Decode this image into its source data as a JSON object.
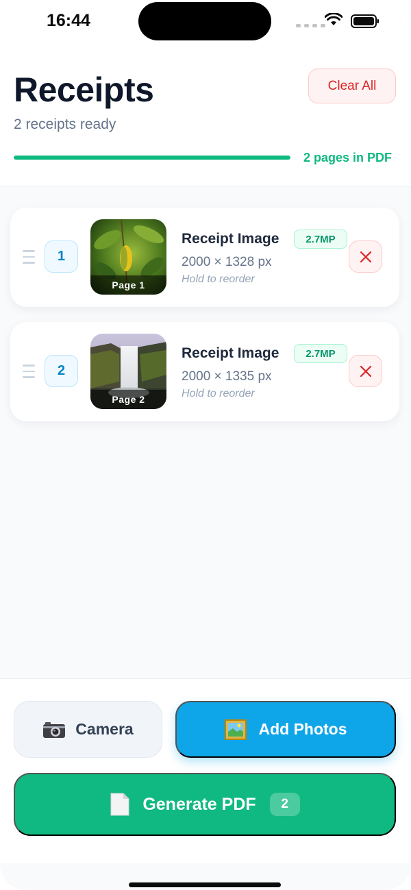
{
  "status_bar": {
    "time": "16:44"
  },
  "header": {
    "title": "Receipts",
    "subtitle": "2 receipts ready",
    "clear_all_label": "Clear All",
    "progress": 1.0,
    "pages_label": "2 pages in PDF"
  },
  "receipts": [
    {
      "index": "1",
      "page_label": "Page 1",
      "title": "Receipt Image",
      "megapixels": "2.7MP",
      "dimensions": "2000 × 1328 px",
      "hint": "Hold to reorder"
    },
    {
      "index": "2",
      "page_label": "Page 2",
      "title": "Receipt Image",
      "megapixels": "2.7MP",
      "dimensions": "2000 × 1335 px",
      "hint": "Hold to reorder"
    }
  ],
  "actions": {
    "camera_label": "Camera",
    "add_photos_label": "Add Photos",
    "generate_label": "Generate PDF",
    "generate_count": "2"
  },
  "icons": {
    "camera": "camera-icon",
    "photos": "framed-picture-icon",
    "document": "document-icon",
    "remove": "close-icon",
    "drag": "drag-handle-icon"
  },
  "colors": {
    "accent_green": "#10b981",
    "accent_blue": "#0ea5e9",
    "danger_red": "#dc2626"
  }
}
